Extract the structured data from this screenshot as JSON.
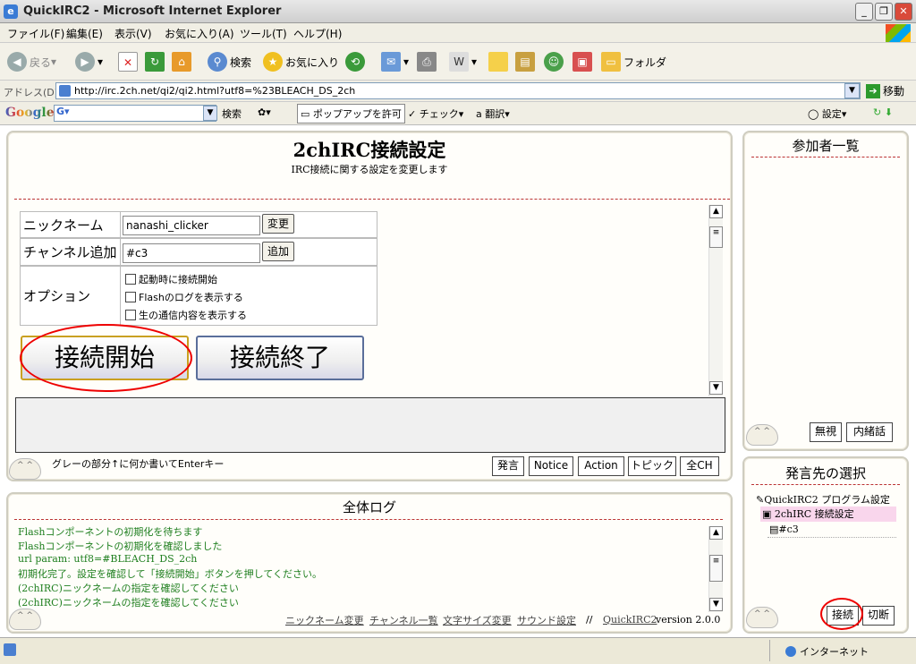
{
  "window": {
    "title": "QuickIRC2 - Microsoft Internet Explorer"
  },
  "menu": [
    "ファイル(F)",
    "編集(E)",
    "表示(V)",
    "お気に入り(A)",
    "ツール(T)",
    "ヘルプ(H)"
  ],
  "toolbar": {
    "back": "戻る",
    "search": "検索",
    "favorites": "お気に入り",
    "folder": "フォルダ"
  },
  "address": {
    "label": "アドレス(D)",
    "url": "http://irc.2ch.net/qi2/qi2.html?utf8=%23BLEACH_DS_2ch",
    "go": "移動"
  },
  "google": {
    "logo": "Google",
    "search": "検索",
    "popup": "ポップアップを許可",
    "check": "チェック",
    "translate": "翻訳",
    "settings": "設定"
  },
  "settings": {
    "title": "2chIRC接続設定",
    "subtitle": "IRC接続に関する設定を変更します",
    "nick_label": "ニックネーム",
    "nick_value": "nanashi_clicker",
    "nick_button": "変更",
    "channel_label": "チャンネル追加",
    "channel_value": "#c3",
    "channel_button": "追加",
    "option_label": "オプション",
    "options": [
      "起動時に接続開始",
      "Flashのログを表示する",
      "生の通信内容を表示する"
    ],
    "connect_button": "接続開始",
    "disconnect_button": "接続終了"
  },
  "input": {
    "hint": "グレーの部分↑に何か書いてEnterキー",
    "buttons": [
      "発言",
      "Notice",
      "Action",
      "トピック",
      "全CH"
    ]
  },
  "log": {
    "title": "全体ログ",
    "lines": [
      "Flashコンポーネントの初期化を待ちます",
      "Flashコンポーネントの初期化を確認しました",
      "url param: utf8=#BLEACH_DS_2ch",
      "初期化完了。設定を確認して「接続開始」ボタンを押してください。",
      "(2chIRC)ニックネームの指定を確認してください",
      "(2chIRC)ニックネームの指定を確認してください"
    ],
    "links": [
      "ニックネーム変更",
      "チャンネル一覧",
      "文字サイズ変更",
      "サウンド設定"
    ],
    "separator": "//",
    "app_link": "QuickIRC2",
    "version": "version 2.0.0"
  },
  "participants": {
    "title": "参加者一覧",
    "ignore": "無視",
    "whisper": "内緒話"
  },
  "target": {
    "title": "発言先の選択",
    "items": [
      "QuickIRC2 プログラム設定",
      "2chIRC 接続設定",
      "#c3"
    ],
    "connect": "接続",
    "disconnect": "切断"
  },
  "status": {
    "zone": "インターネット"
  },
  "mascot": "^  ^",
  "colors": {
    "highlight": "#f9d6ec",
    "log_text": "#1f7f1f",
    "annotation": "#e00000"
  }
}
